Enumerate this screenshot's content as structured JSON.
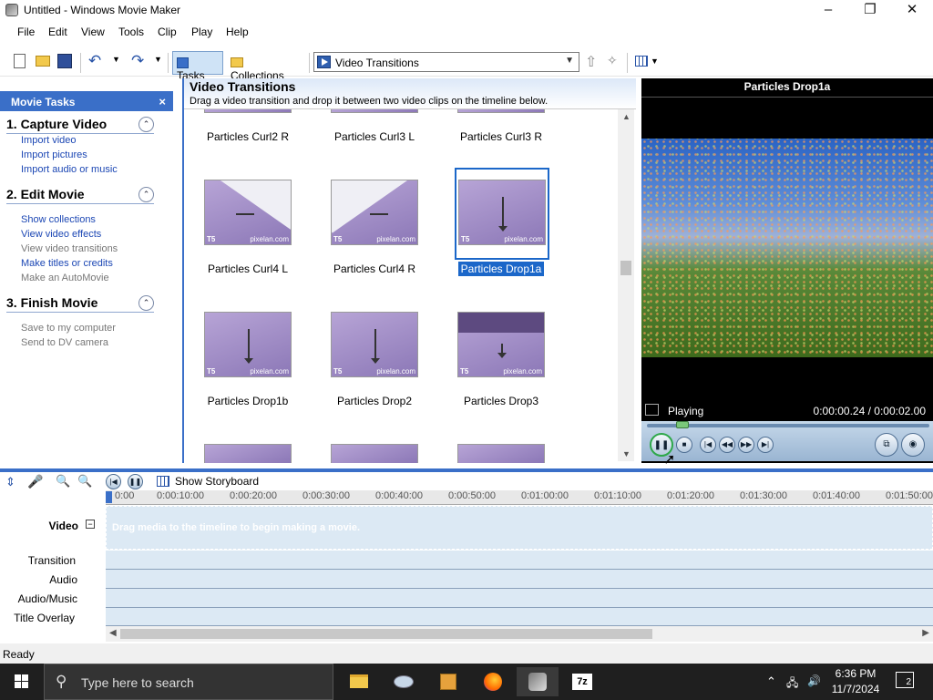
{
  "window": {
    "title": "Untitled - Windows Movie Maker",
    "minimize": "–",
    "maximize": "❐",
    "close": "✕"
  },
  "menu": [
    "File",
    "Edit",
    "View",
    "Tools",
    "Clip",
    "Play",
    "Help"
  ],
  "toolbar": {
    "tasks": "Tasks",
    "collections": "Collections",
    "dropdown_value": "Video Transitions"
  },
  "taskpane": {
    "header": "Movie Tasks",
    "close": "×",
    "sections": [
      {
        "title": "1. Capture Video",
        "links": [
          {
            "label": "Import video",
            "enabled": true
          },
          {
            "label": "Import pictures",
            "enabled": true
          },
          {
            "label": "Import audio or music",
            "enabled": true
          }
        ]
      },
      {
        "title": "2. Edit Movie",
        "links": [
          {
            "label": "Show collections",
            "enabled": true
          },
          {
            "label": "View video effects",
            "enabled": true
          },
          {
            "label": "View video transitions",
            "enabled": false
          },
          {
            "label": "Make titles or credits",
            "enabled": true
          },
          {
            "label": "Make an AutoMovie",
            "enabled": false
          }
        ]
      },
      {
        "title": "3. Finish Movie",
        "links": [
          {
            "label": "Save to my computer",
            "enabled": false
          },
          {
            "label": "Send to DV camera",
            "enabled": false
          }
        ]
      }
    ]
  },
  "content": {
    "title": "Video Transitions",
    "description": "Drag a video transition and drop it between two video clips on the timeline below.",
    "thumb_ts": "T5",
    "thumb_wm": "pixelan.com",
    "top_labels": [
      "Particles Curl2 R",
      "Particles Curl3 L",
      "Particles Curl3 R"
    ],
    "row1": [
      "Particles Curl4 L",
      "Particles Curl4 R",
      "Particles Drop1a"
    ],
    "row2": [
      "Particles Drop1b",
      "Particles Drop2",
      "Particles Drop3"
    ],
    "selected": "Particles Drop1a"
  },
  "preview": {
    "title": "Particles Drop1a",
    "status": "Playing",
    "time": "0:00:00.24 / 0:00:02.00"
  },
  "timeline": {
    "show_storyboard": "Show Storyboard",
    "ticks": [
      "0:00",
      "0:00:10:00",
      "0:00:20:00",
      "0:00:30:00",
      "0:00:40:00",
      "0:00:50:00",
      "0:01:00:00",
      "0:01:10:00",
      "0:01:20:00",
      "0:01:30:00",
      "0:01:40:00",
      "0:01:50:00"
    ],
    "tracks": [
      "Video",
      "Transition",
      "Audio",
      "Audio/Music",
      "Title Overlay"
    ],
    "placeholder": "Drag media to the timeline to begin making a movie."
  },
  "status": "Ready",
  "taskbar": {
    "search_placeholder": "Type here to search",
    "time": "6:36 PM",
    "date": "11/7/2024",
    "notifications": "2"
  }
}
